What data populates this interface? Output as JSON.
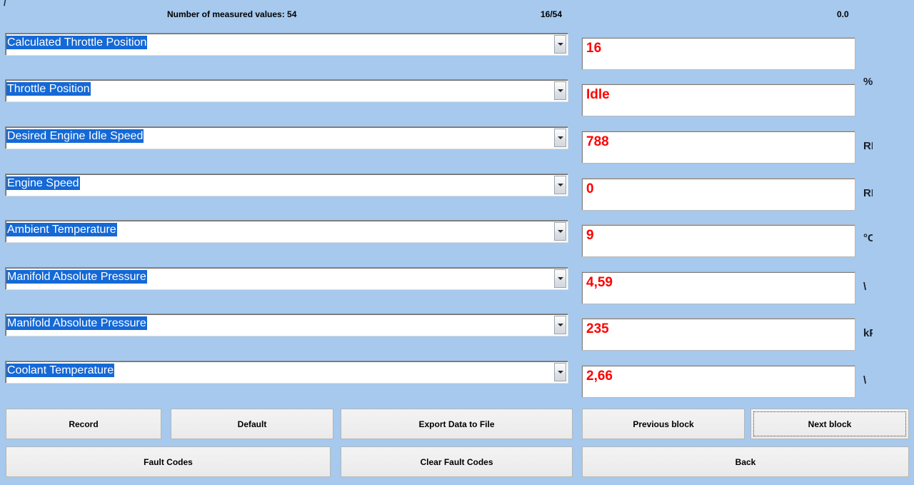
{
  "header": {
    "corner_mark": "/",
    "measured_values_label": "Number of measured values: 54",
    "block_index": "16/54",
    "refresh_rate": "0.0"
  },
  "colors": {
    "background": "#a6c9ed",
    "selection": "#1569d6",
    "value_text": "#ff0000",
    "button_face": "#efefef"
  },
  "rows": [
    {
      "parameter": "Calculated Throttle Position",
      "value": "16",
      "unit": "%"
    },
    {
      "parameter": "Throttle Position",
      "value": "Idle",
      "unit": ""
    },
    {
      "parameter": "Desired Engine Idle Speed",
      "value": "788",
      "unit": "RPM"
    },
    {
      "parameter": "Engine Speed",
      "value": "0",
      "unit": "RPM"
    },
    {
      "parameter": "Ambient Temperature",
      "value": "9",
      "unit": "°C"
    },
    {
      "parameter": "Manifold Absolute Pressure",
      "value": "4,59",
      "unit": "\\"
    },
    {
      "parameter": "Manifold Absolute Pressure",
      "value": "235",
      "unit": "kPa"
    },
    {
      "parameter": "Coolant Temperature",
      "value": "2,66",
      "unit": "\\"
    }
  ],
  "dropdown_icon": "chevron-down-icon",
  "buttons": {
    "record": "Record",
    "default": "Default",
    "export_data": "Export Data to File",
    "previous_block": "Previous block",
    "next_block": "Next block",
    "fault_codes": "Fault Codes",
    "clear_fault_codes": "Clear Fault Codes",
    "back": "Back"
  }
}
